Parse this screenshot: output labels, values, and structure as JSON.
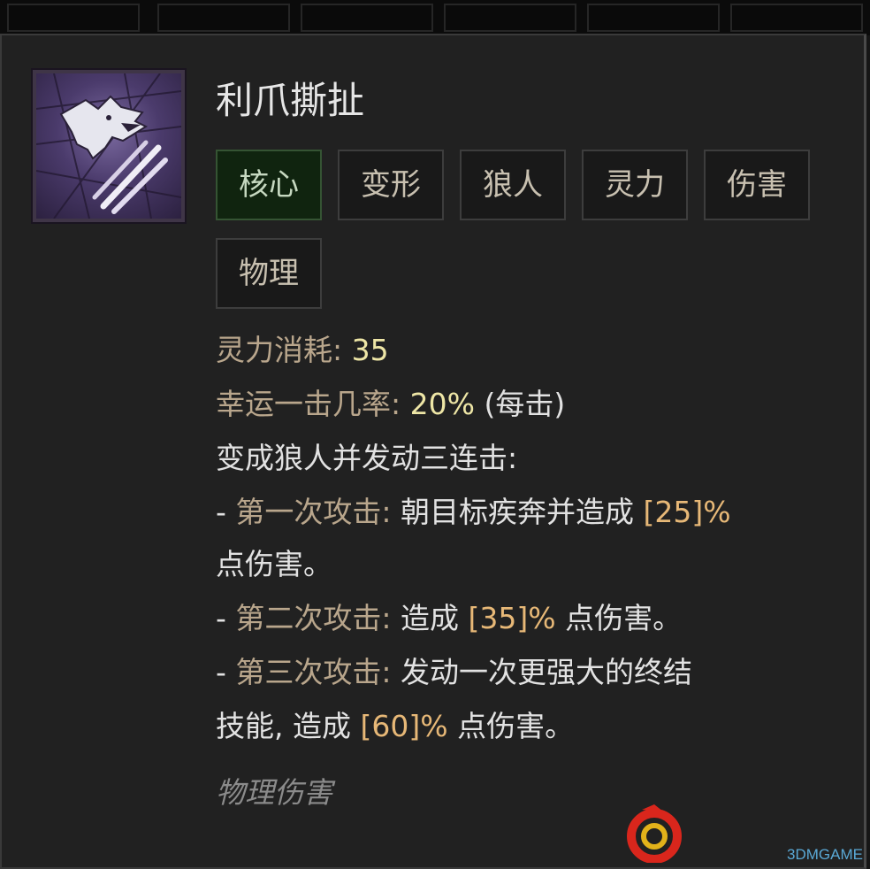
{
  "skill": {
    "name": "利爪撕扯",
    "icon": "werewolf-claw-icon",
    "tags": [
      "核心",
      "变形",
      "狼人",
      "灵力",
      "伤害",
      "物理"
    ]
  },
  "stats": {
    "cost_label": "灵力消耗:",
    "cost_value": "35",
    "lucky_label": "幸运一击几率:",
    "lucky_value": "20%",
    "lucky_suffix": "(每击)"
  },
  "description": {
    "intro": "变成狼人并发动三连击:",
    "dash": "-",
    "hit1_label": "第一次攻击:",
    "hit1_text": "朝目标疾奔并造成",
    "hit1_value": "[25]%",
    "hit1_tail": "点伤害。",
    "hit2_label": "第二次攻击:",
    "hit2_text": "造成",
    "hit2_value": "[35]%",
    "hit2_tail": "点伤害。",
    "hit3_label": "第三次攻击:",
    "hit3_text": "发动一次更强大的终结",
    "hit3_text2": "技能, 造成",
    "hit3_value": "[60]%",
    "hit3_tail": "点伤害。"
  },
  "footer": "物理伤害",
  "watermark": {
    "text": "3DMGAME"
  },
  "colors": {
    "core_tag_bg": "#10240f",
    "label": "#b9a68c",
    "value": "#eee6a6",
    "number": "#e7b877"
  }
}
